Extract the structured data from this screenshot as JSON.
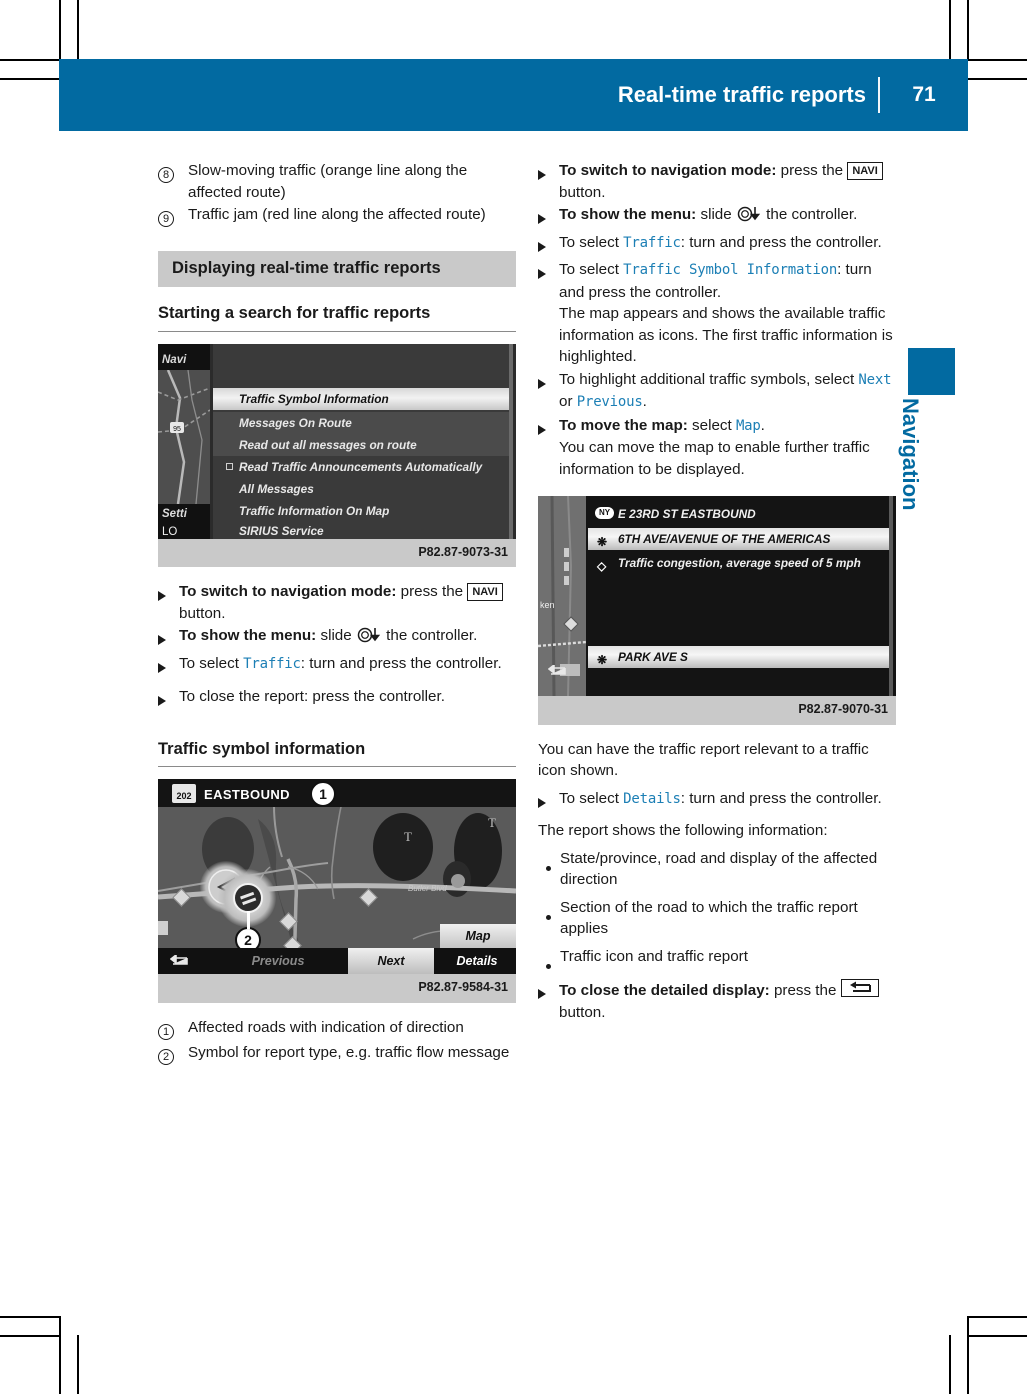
{
  "header": {
    "title": "Real-time traffic reports",
    "page_number": "71"
  },
  "side_tab": {
    "label": "Navigation"
  },
  "left_column": {
    "legend": [
      {
        "num": "8",
        "text": "Slow-moving traffic (orange line along the affected route)"
      },
      {
        "num": "9",
        "text": "Traffic jam (red line along the affected route)"
      }
    ],
    "section_heading": "Displaying real-time traffic reports",
    "sub_heading": "Starting a search for traffic reports",
    "figure_menu": {
      "caption": "P82.87-9073-31",
      "side_labels": {
        "navi": "Navi",
        "settings": "Setti",
        "lo": "LO"
      },
      "items": [
        "Traffic Symbol Information",
        "Messages On Route",
        "Read out all messages on route",
        "Read Traffic Announcements Automatically",
        "All Messages",
        "Traffic Information On Map",
        "SIRIUS Service"
      ]
    },
    "steps": [
      {
        "bold": "To switch to navigation mode:",
        "rest": " press the ",
        "key": "NAVI",
        "tail": " button."
      },
      {
        "bold": "To show the menu:",
        "rest": " slide ",
        "glyph": "controller-down",
        "tail": " the controller."
      },
      {
        "pre": "To select ",
        "ui": "Traffic",
        "tail": ": turn and press the controller."
      },
      {
        "plain": "To close the report: press the controller."
      }
    ],
    "sub_heading_2": "Traffic symbol information",
    "figure_map": {
      "caption": "P82.87-9584-31",
      "route_shield": "202",
      "direction": "EASTBOUND",
      "road_label": "Butler Blvd",
      "callouts": [
        "1",
        "2"
      ],
      "buttons": {
        "map": "Map",
        "previous": "Previous",
        "next": "Next",
        "details": "Details"
      }
    },
    "map_legend": [
      {
        "num": "1",
        "text": "Affected roads with indication of direction"
      },
      {
        "num": "2",
        "text": "Symbol for report type, e.g. traffic flow message"
      }
    ]
  },
  "right_column": {
    "steps_top": [
      {
        "bold": "To switch to navigation mode:",
        "rest": " press the ",
        "key": "NAVI",
        "tail": " button."
      },
      {
        "bold": "To show the menu:",
        "rest": " slide ",
        "glyph": "controller-down",
        "tail": " the controller."
      },
      {
        "pre": "To select ",
        "ui": "Traffic",
        "tail": ": turn and press the controller."
      },
      {
        "pre": "To select ",
        "ui": "Traffic Symbol Information",
        "tail": ": turn and press the controller.",
        "extra": "The map appears and shows the available traffic information as icons. The first traffic information is highlighted."
      },
      {
        "pre2": "To highlight additional traffic symbols, select ",
        "ui_a": "Next",
        "mid": " or ",
        "ui_b": "Previous",
        "tail2": "."
      },
      {
        "bold": "To move the map:",
        "rest": " select ",
        "ui": "Map",
        "tail": ".",
        "extra": "You can move the map to enable further traffic information to be displayed."
      }
    ],
    "figure_report": {
      "caption": "P82.87-9070-31",
      "state_badge": "NY",
      "rows": [
        "E 23RD ST EASTBOUND",
        "6TH AVE/AVENUE OF THE AMERICAS",
        "Traffic congestion, average speed of 5 mph",
        "PARK AVE S"
      ]
    },
    "paragraph_1": "You can have the traffic report relevant to a traffic icon shown.",
    "step_details": {
      "pre": "To select ",
      "ui": "Details",
      "tail": ": turn and press the controller."
    },
    "paragraph_2": "The report shows the following information:",
    "bullets": [
      "State/province, road and display of the affected direction",
      "Section of the road to which the traffic report applies",
      "Traffic icon and traffic report"
    ],
    "step_close": {
      "bold": "To close the detailed display:",
      "rest": " press the ",
      "key": "back-button",
      "tail": " button."
    }
  },
  "colors": {
    "brand_blue": "#026AA1",
    "ui_term_teal": "#1c7fb5",
    "grey_band": "#c9c9c9"
  }
}
